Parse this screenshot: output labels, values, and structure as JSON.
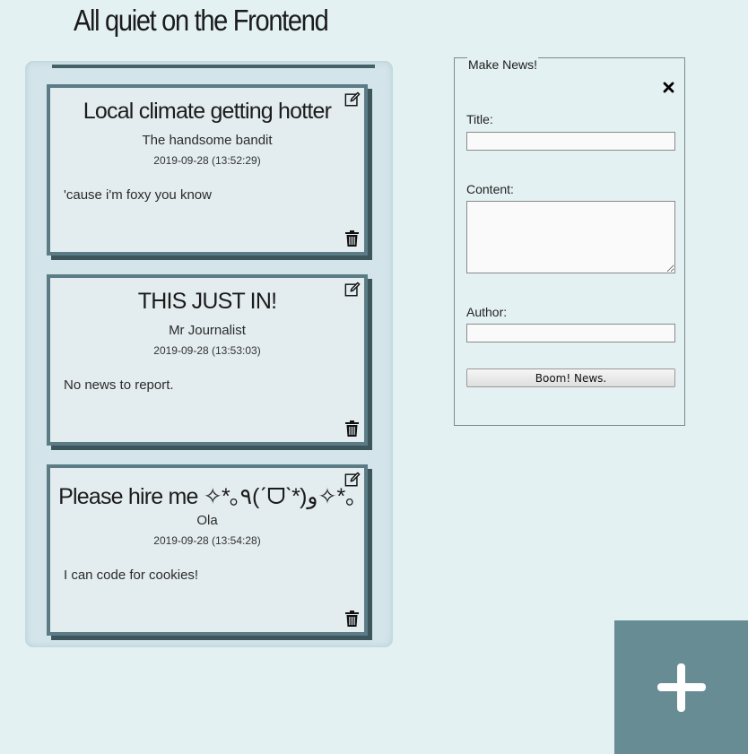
{
  "page": {
    "title": "All quiet on the Frontend"
  },
  "articles": [
    {
      "title": "Local climate getting hotter",
      "author": "The handsome bandit",
      "date": "2019-09-28 (13:52:29)",
      "content": "'cause i'm foxy you know"
    },
    {
      "title": "THIS JUST IN!",
      "author": "Mr Journalist",
      "date": "2019-09-28 (13:53:03)",
      "content": "No news to report."
    },
    {
      "title": "Please hire me ✧*｡٩(ˊᗜˋ*)و✧*｡",
      "author": "Ola",
      "date": "2019-09-28 (13:54:28)",
      "content": "I can code for cookies!"
    }
  ],
  "form": {
    "legend": "Make News!",
    "title_label": "Title:",
    "title_value": "",
    "content_label": "Content:",
    "content_value": "",
    "author_label": "Author:",
    "author_value": "",
    "submit_label": "Boom! News."
  },
  "icons": {
    "edit": "edit-icon",
    "trash": "trash-icon",
    "close": "close-icon",
    "add": "plus-icon"
  },
  "colors": {
    "background": "#e4f1f3",
    "card_border": "#5b7b85",
    "card_shadow": "#3d555c",
    "fab": "#688c94"
  }
}
